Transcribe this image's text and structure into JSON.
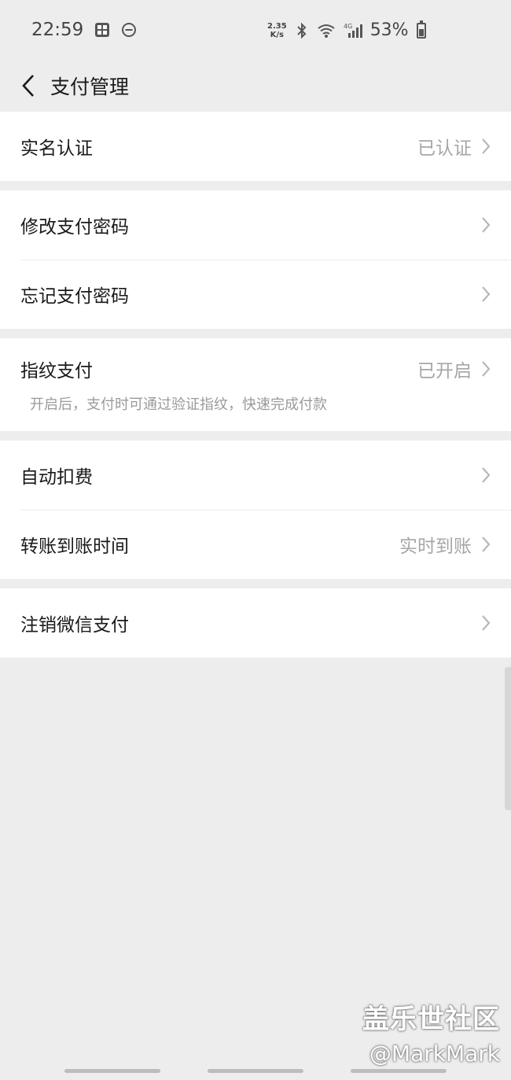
{
  "status_bar": {
    "time": "22:59",
    "speed_value": "2.35",
    "speed_unit": "K/s",
    "network": "4G",
    "battery": "53%"
  },
  "header": {
    "title": "支付管理"
  },
  "sections": [
    {
      "rows": [
        {
          "label": "实名认证",
          "value": "已认证"
        }
      ]
    },
    {
      "rows": [
        {
          "label": "修改支付密码",
          "value": ""
        },
        {
          "label": "忘记支付密码",
          "value": ""
        }
      ]
    },
    {
      "rows": [
        {
          "label": "指纹支付",
          "value": "已开启",
          "description": "开启后，支付时可通过验证指纹，快速完成付款"
        }
      ]
    },
    {
      "rows": [
        {
          "label": "自动扣费",
          "value": ""
        },
        {
          "label": "转账到账时间",
          "value": "实时到账"
        }
      ]
    },
    {
      "rows": [
        {
          "label": "注销微信支付",
          "value": ""
        }
      ]
    }
  ],
  "watermark": {
    "line1": "盖乐世社区",
    "line2": "@MarkMark"
  }
}
